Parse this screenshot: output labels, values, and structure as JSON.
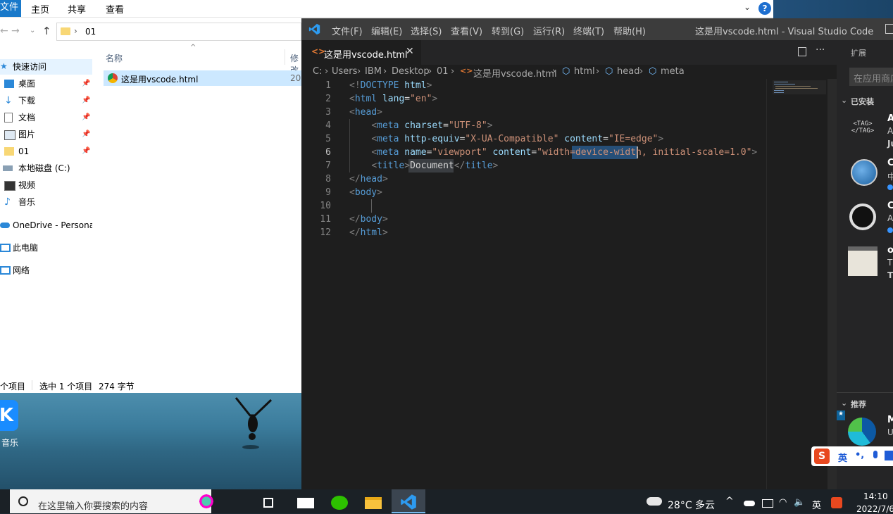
{
  "explorer": {
    "ribbon_tabs": [
      "文件",
      "主页",
      "共享",
      "查看"
    ],
    "help": "?",
    "path_crumb": "01",
    "col_name": "名称",
    "col_modified": "修改",
    "nav": [
      {
        "label": "快速访问",
        "pin": false
      },
      {
        "label": "桌面",
        "pin": true
      },
      {
        "label": "下载",
        "pin": true
      },
      {
        "label": "文档",
        "pin": true
      },
      {
        "label": "图片",
        "pin": true
      },
      {
        "label": "01",
        "pin": true
      },
      {
        "label": "本地磁盘 (C:)",
        "pin": false
      },
      {
        "label": "视频",
        "pin": false
      },
      {
        "label": "音乐",
        "pin": false
      },
      {
        "label": "OneDrive - Persona",
        "pin": false
      },
      {
        "label": "此电脑",
        "pin": false
      },
      {
        "label": "网络",
        "pin": false
      }
    ],
    "file": {
      "name": "这是用vscode.html",
      "date_prefix": "20"
    },
    "status": {
      "count": "个项目",
      "selected": "选中 1 个项目",
      "size": "274 字节"
    }
  },
  "desktop": {
    "icon_label": "音乐",
    "icon_glyph": "K"
  },
  "vscode": {
    "menu": [
      "文件(F)",
      "编辑(E)",
      "选择(S)",
      "查看(V)",
      "转到(G)",
      "运行(R)",
      "终端(T)",
      "帮助(H)"
    ],
    "window_title": "这是用vscode.html - Visual Studio Code",
    "tab": "这是用vscode.html",
    "breadcrumb": [
      "C:",
      "Users",
      "IBM",
      "Desktop",
      "01",
      "这是用vscode.html",
      "html",
      "head",
      "meta"
    ],
    "lines": [
      {
        "n": "1",
        "code": "<!DOCTYPE html>"
      },
      {
        "n": "2",
        "code": "<html lang=\"en\">"
      },
      {
        "n": "3",
        "code": "<head>"
      },
      {
        "n": "4",
        "code": "    <meta charset=\"UTF-8\">"
      },
      {
        "n": "5",
        "code": "    <meta http-equiv=\"X-UA-Compatible\" content=\"IE=edge\">"
      },
      {
        "n": "6",
        "code": "    <meta name=\"viewport\" content=\"width=device-width, initial-scale=1.0\">"
      },
      {
        "n": "7",
        "code": "    <title>Document</title>"
      },
      {
        "n": "8",
        "code": "</head>"
      },
      {
        "n": "9",
        "code": "<body>"
      },
      {
        "n": "10",
        "code": ""
      },
      {
        "n": "11",
        "code": "</body>"
      },
      {
        "n": "12",
        "code": "</html>"
      }
    ],
    "extensions": {
      "title": "扩展",
      "search_placeholder": "在应用商店",
      "installed": "已安装",
      "recommended": "推荐",
      "items": [
        {
          "c1": "A",
          "c2": "A",
          "c3": "Ju"
        },
        {
          "c1": "C",
          "c2": "中",
          "c3": ""
        },
        {
          "c1": "C",
          "c2": "A",
          "c3": ""
        },
        {
          "c1": "o",
          "c2": "T",
          "c3": "T"
        }
      ],
      "rec_item": {
        "c1": "M",
        "c2": "U"
      }
    }
  },
  "ime": {
    "label": "英",
    "punct": "•,",
    "logo": "S"
  },
  "taskbar": {
    "search_placeholder": "在这里输入你要搜索的内容",
    "weather": "28°C 多云",
    "lang": "英",
    "time": "14:10",
    "date": "2022/7/6"
  },
  "colors": {
    "accent": "#007acc",
    "explorer_ribbon": "#1979ca",
    "selection": "#cce8ff"
  }
}
